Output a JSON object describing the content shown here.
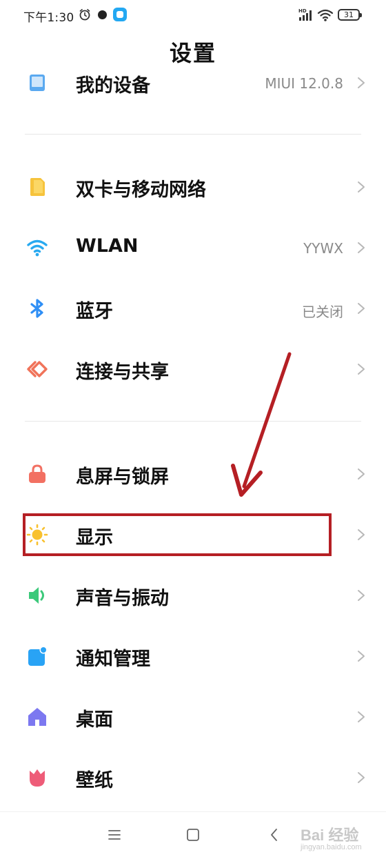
{
  "status_bar": {
    "time": "下午1:30",
    "battery": "31"
  },
  "title": "设置",
  "rows": [
    {
      "label": "我的设备",
      "value": "MIUI 12.0.8",
      "icon": "device-icon"
    },
    {
      "label": "双卡与移动网络",
      "value": "",
      "icon": "sim-card-icon"
    },
    {
      "label": "WLAN",
      "value": "YYWX",
      "icon": "wifi-icon"
    },
    {
      "label": "蓝牙",
      "value": "已关闭",
      "icon": "bluetooth-icon"
    },
    {
      "label": "连接与共享",
      "value": "",
      "icon": "connection-share-icon"
    },
    {
      "label": "息屏与锁屏",
      "value": "",
      "icon": "lock-icon"
    },
    {
      "label": "显示",
      "value": "",
      "icon": "sun-icon"
    },
    {
      "label": "声音与振动",
      "value": "",
      "icon": "speaker-icon"
    },
    {
      "label": "通知管理",
      "value": "",
      "icon": "notification-icon"
    },
    {
      "label": "桌面",
      "value": "",
      "icon": "home-icon"
    },
    {
      "label": "壁纸",
      "value": "",
      "icon": "tulip-icon"
    }
  ],
  "colors": {
    "accent_highlight": "#b51f24",
    "sim_card": "#f6c33c",
    "wifi": "#28a9f0",
    "bluetooth": "#2f8ff5",
    "share": "#f0735a",
    "lock": "#f27062",
    "sun": "#f8c12f",
    "speaker": "#3cc97a",
    "notification": "#29a3f5",
    "home": "#7c78f0",
    "tulip": "#ee5c78"
  },
  "watermark": {
    "brand": "Bai 经验",
    "url": "jingyan.baidu.com"
  }
}
